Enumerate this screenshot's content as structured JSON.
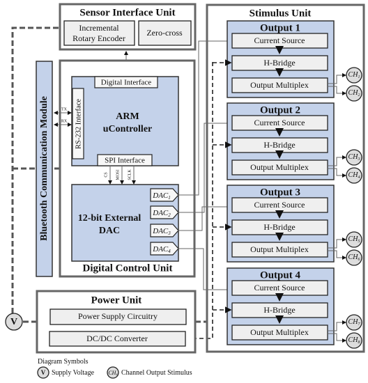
{
  "sensor_unit": {
    "title": "Sensor Interface Unit",
    "encoder_line1": "Incremental",
    "encoder_line2": "Rotary Encoder",
    "zero_cross": "Zero-cross"
  },
  "bluetooth": {
    "label": "Bluetooth Communication Module"
  },
  "digital_control": {
    "title": "Digital Control Unit",
    "arm_line1": "ARM",
    "arm_line2": "uController",
    "digital_interface": "Digital Interface",
    "rs232": "RS-232 Interface",
    "spi": "SPI Interface",
    "tx": "TX",
    "rx": "RX",
    "spi_signals": [
      "CS",
      "MOSI",
      "SCLK"
    ],
    "dac_line1": "12-bit External",
    "dac_line2": "DAC",
    "dac_outputs": [
      {
        "base": "DAC",
        "sub": "1"
      },
      {
        "base": "DAC",
        "sub": "2"
      },
      {
        "base": "DAC",
        "sub": "3"
      },
      {
        "base": "DAC",
        "sub": "4"
      }
    ]
  },
  "stimulus_unit": {
    "title": "Stimulus Unit",
    "outputs": [
      {
        "title": "Output 1",
        "blocks": [
          "Current Source",
          "H-Bridge",
          "Output Multiplex"
        ],
        "channels": [
          "1",
          "2"
        ]
      },
      {
        "title": "Output 2",
        "blocks": [
          "Current Source",
          "H-Bridge",
          "Output Multiplex"
        ],
        "channels": [
          "3",
          "4"
        ]
      },
      {
        "title": "Output 3",
        "blocks": [
          "Current Source",
          "H-Bridge",
          "Output Multiplex"
        ],
        "channels": [
          "5",
          "6"
        ]
      },
      {
        "title": "Output 4",
        "blocks": [
          "Current Source",
          "H-Bridge",
          "Output Multiplex"
        ],
        "channels": [
          "7",
          "8"
        ]
      }
    ],
    "channel_prefix": "CH"
  },
  "power_unit": {
    "title": "Power Unit",
    "supply": "Power Supply Circuitry",
    "dcdc": "DC/DC Converter",
    "voltage_symbol": "V"
  },
  "legend": {
    "title": "Diagram Symbols",
    "voltage_symbol": "V",
    "voltage_label": "Supply Voltage",
    "channel_symbol_base": "CH",
    "channel_symbol_sub": "x",
    "channel_label": "Channel Output Stimulus"
  },
  "colors": {
    "block_blue": "#c4d2ea",
    "block_grey": "#efefef",
    "border": "#666666"
  }
}
